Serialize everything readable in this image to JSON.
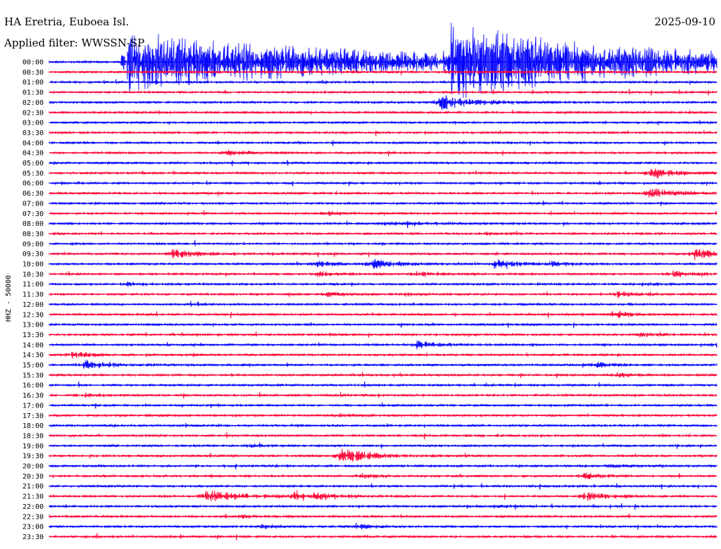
{
  "header": {
    "station": "HA Eretria, Euboea Isl.",
    "date": "2025-09-10",
    "filter": "Applied filter: WWSSN-SP"
  },
  "channel_label": "HHZ - 50000",
  "colors": {
    "trace_a": "#0000ff",
    "trace_b": "#ff0033",
    "background": "#ffffff"
  },
  "chart_data": {
    "type": "line",
    "title": "HA Eretria, Euboea Isl.",
    "subtitle": "Applied filter: WWSSN-SP",
    "ylabel": "HHZ - 50000",
    "xlabel": "",
    "grid": false,
    "legend": "none",
    "rows": [
      "00:00",
      "00:30",
      "01:00",
      "01:30",
      "02:00",
      "02:30",
      "03:00",
      "03:30",
      "04:00",
      "04:30",
      "05:00",
      "05:30",
      "06:00",
      "06:30",
      "07:00",
      "07:30",
      "08:00",
      "08:30",
      "09:00",
      "09:30",
      "10:00",
      "10:30",
      "11:00",
      "11:30",
      "12:00",
      "12:30",
      "13:00",
      "13:30",
      "14:00",
      "14:30",
      "15:00",
      "15:30",
      "16:00",
      "16:30",
      "17:00",
      "17:30",
      "18:00",
      "18:30",
      "19:00",
      "19:30",
      "20:00",
      "20:30",
      "21:00",
      "21:30",
      "22:00",
      "22:30",
      "23:00",
      "23:30"
    ],
    "row_minutes": 30,
    "events": [
      {
        "row": 0,
        "minute": 3.5,
        "amp": 8.0,
        "duration": 30
      },
      {
        "row": 0,
        "minute": 18.0,
        "amp": 8.0,
        "duration": 25
      },
      {
        "row": 4,
        "minute": 17.5,
        "amp": 2.0,
        "duration": 4
      },
      {
        "row": 9,
        "minute": 8.0,
        "amp": 0.7,
        "duration": 2
      },
      {
        "row": 11,
        "minute": 27.0,
        "amp": 1.5,
        "duration": 3
      },
      {
        "row": 13,
        "minute": 27.0,
        "amp": 1.3,
        "duration": 3
      },
      {
        "row": 15,
        "minute": 12.5,
        "amp": 0.5,
        "duration": 1.5
      },
      {
        "row": 16,
        "minute": 15.0,
        "amp": 0.3,
        "duration": 8
      },
      {
        "row": 17,
        "minute": 19.5,
        "amp": 0.4,
        "duration": 2
      },
      {
        "row": 19,
        "minute": 5.5,
        "amp": 1.2,
        "duration": 3
      },
      {
        "row": 19,
        "minute": 29.0,
        "amp": 1.5,
        "duration": 2
      },
      {
        "row": 20,
        "minute": 12.0,
        "amp": 0.8,
        "duration": 2.5
      },
      {
        "row": 20,
        "minute": 14.5,
        "amp": 1.2,
        "duration": 3
      },
      {
        "row": 20,
        "minute": 20.0,
        "amp": 1.0,
        "duration": 3
      },
      {
        "row": 20,
        "minute": 22.5,
        "amp": 0.6,
        "duration": 2
      },
      {
        "row": 21,
        "minute": 12.0,
        "amp": 0.6,
        "duration": 2
      },
      {
        "row": 21,
        "minute": 16.5,
        "amp": 0.6,
        "duration": 2
      },
      {
        "row": 21,
        "minute": 28.0,
        "amp": 0.8,
        "duration": 2
      },
      {
        "row": 22,
        "minute": 3.5,
        "amp": 0.5,
        "duration": 2
      },
      {
        "row": 22,
        "minute": 26.5,
        "amp": 0.5,
        "duration": 2
      },
      {
        "row": 23,
        "minute": 12.5,
        "amp": 0.6,
        "duration": 2
      },
      {
        "row": 23,
        "minute": 16.0,
        "amp": 0.4,
        "duration": 2
      },
      {
        "row": 23,
        "minute": 25.5,
        "amp": 0.8,
        "duration": 2
      },
      {
        "row": 25,
        "minute": 25.5,
        "amp": 0.8,
        "duration": 2
      },
      {
        "row": 27,
        "minute": 26.5,
        "amp": 0.7,
        "duration": 2
      },
      {
        "row": 28,
        "minute": 16.5,
        "amp": 1.0,
        "duration": 3
      },
      {
        "row": 28,
        "minute": 30.0,
        "amp": 0.8,
        "duration": 1
      },
      {
        "row": 29,
        "minute": 1.0,
        "amp": 1.0,
        "duration": 2
      },
      {
        "row": 30,
        "minute": 1.5,
        "amp": 1.3,
        "duration": 3
      },
      {
        "row": 30,
        "minute": 24.5,
        "amp": 0.7,
        "duration": 2
      },
      {
        "row": 31,
        "minute": 25.5,
        "amp": 0.6,
        "duration": 2
      },
      {
        "row": 33,
        "minute": 1.5,
        "amp": 0.5,
        "duration": 2
      },
      {
        "row": 35,
        "minute": 13.0,
        "amp": 0.4,
        "duration": 3
      },
      {
        "row": 38,
        "minute": 9.0,
        "amp": 0.4,
        "duration": 2
      },
      {
        "row": 39,
        "minute": 13.0,
        "amp": 2.0,
        "duration": 4
      },
      {
        "row": 40,
        "minute": 25.0,
        "amp": 0.4,
        "duration": 3
      },
      {
        "row": 41,
        "minute": 14.0,
        "amp": 0.6,
        "duration": 2
      },
      {
        "row": 41,
        "minute": 24.0,
        "amp": 0.9,
        "duration": 2
      },
      {
        "row": 43,
        "minute": 7.0,
        "amp": 1.7,
        "duration": 4
      },
      {
        "row": 43,
        "minute": 11.0,
        "amp": 1.5,
        "duration": 4
      },
      {
        "row": 43,
        "minute": 24.0,
        "amp": 1.2,
        "duration": 3
      },
      {
        "row": 44,
        "minute": 20.0,
        "amp": 0.3,
        "duration": 2
      },
      {
        "row": 45,
        "minute": 8.5,
        "amp": 0.4,
        "duration": 2
      },
      {
        "row": 46,
        "minute": 9.5,
        "amp": 0.5,
        "duration": 2
      },
      {
        "row": 46,
        "minute": 14.0,
        "amp": 0.5,
        "duration": 2
      }
    ]
  }
}
